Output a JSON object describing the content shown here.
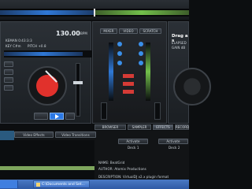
{
  "deck_left": {
    "song": "KEMAN 0:43:3:3",
    "key": "KEY C#m",
    "pitch": "PITCH +0.8",
    "bpm": "130.00",
    "bpm_label": "BPM"
  },
  "deck_right": {
    "title": "Drag a s",
    "elapsed": "ELAPSED",
    "gain": "GAIN dB"
  },
  "mixer": {
    "tabs": [
      "MIXER",
      "VIDEO",
      "SCRATCH"
    ]
  },
  "bottom_tabs": [
    "BROWSER",
    "SAMPLER",
    "EFFECTS",
    "RECORD"
  ],
  "effects_tabs": [
    "Video Effects",
    "Video Transitions"
  ],
  "plugin": {
    "name": "NAME: BeatGrid",
    "author": "AUTHOR: Atomix Productions",
    "description": "DESCRIPTION: VirtualDJ v2.x plugin format"
  },
  "actions": {
    "activate_left": "Activate",
    "deck_left": "Deck 1",
    "activate_right": "Activate",
    "deck_right": "Deck 2"
  },
  "taskbar": {
    "item": "C:\\Documents and Set..."
  },
  "colors": {
    "accent_blue": "#2f78d6",
    "play_blue": "#2b78e4",
    "platter_red": "#e1312c",
    "waveform_green": "#72c04b",
    "effects_green": "#7ea65d"
  }
}
